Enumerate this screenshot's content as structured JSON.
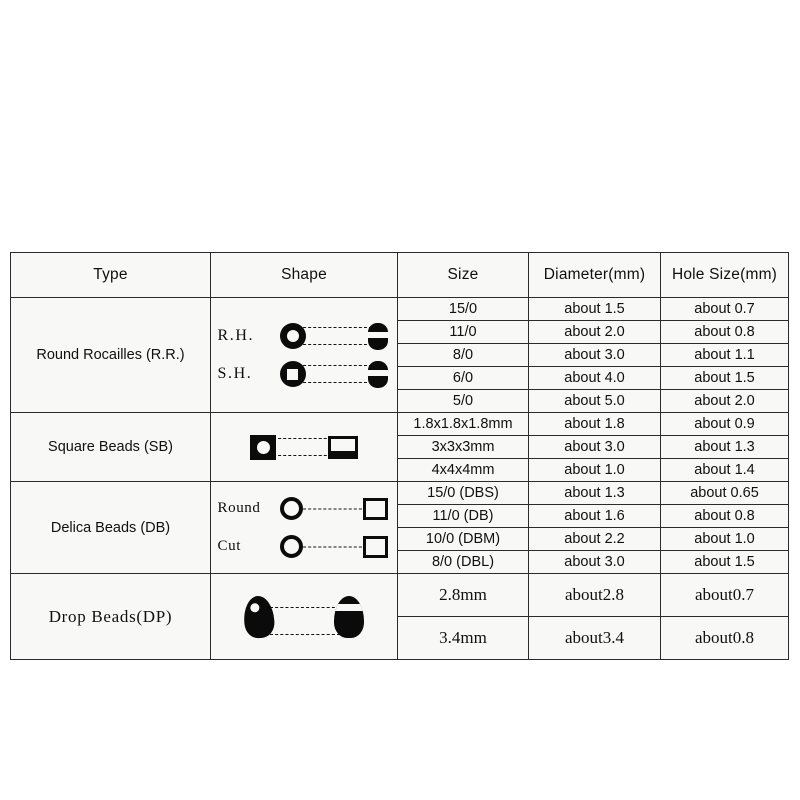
{
  "table": {
    "headers": {
      "type": "Type",
      "shape": "Shape",
      "size": "Size",
      "diameter": "Diameter(mm)",
      "hole": "Hole Size(mm)"
    },
    "sections": [
      {
        "name": "Round Rocailles  (R.R.)",
        "shape_labels": {
          "first": "R.H.",
          "second": "S.H."
        },
        "rows": [
          {
            "size": "15/0",
            "diameter": "about 1.5",
            "hole": "about 0.7"
          },
          {
            "size": "11/0",
            "diameter": "about 2.0",
            "hole": "about 0.8"
          },
          {
            "size": "8/0",
            "diameter": "about 3.0",
            "hole": "about 1.1"
          },
          {
            "size": "6/0",
            "diameter": "about 4.0",
            "hole": "about 1.5"
          },
          {
            "size": "5/0",
            "diameter": "about 5.0",
            "hole": "about 2.0"
          }
        ]
      },
      {
        "name": "Square Beads  (SB)",
        "shape_labels": {
          "first": "",
          "second": ""
        },
        "rows": [
          {
            "size": "1.8x1.8x1.8mm",
            "diameter": "about 1.8",
            "hole": "about 0.9"
          },
          {
            "size": "3x3x3mm",
            "diameter": "about 3.0",
            "hole": "about 1.3"
          },
          {
            "size": "4x4x4mm",
            "diameter": "about 1.0",
            "hole": "about 1.4"
          }
        ]
      },
      {
        "name": "Delica Beads  (DB)",
        "shape_labels": {
          "first": "Round",
          "second": "Cut"
        },
        "rows": [
          {
            "size": "15/0  (DBS)",
            "diameter": "about 1.3",
            "hole": "about 0.65"
          },
          {
            "size": "11/0  (DB)",
            "diameter": "about 1.6",
            "hole": "about 0.8"
          },
          {
            "size": "10/0  (DBM)",
            "diameter": "about 2.2",
            "hole": "about 1.0"
          },
          {
            "size": "8/0  (DBL)",
            "diameter": "about 3.0",
            "hole": "about 1.5"
          }
        ]
      },
      {
        "name": "Drop Beads(DP)",
        "shape_labels": {
          "first": "",
          "second": ""
        },
        "rows": [
          {
            "size": "2.8mm",
            "diameter": "about2.8",
            "hole": "about0.7"
          },
          {
            "size": "3.4mm",
            "diameter": "about3.4",
            "hole": "about0.8"
          }
        ]
      }
    ]
  },
  "colors": {
    "ink": "#101010",
    "border": "#2b2b2b",
    "cell_bg": "#f8f8f6",
    "page_bg": "#ffffff"
  }
}
